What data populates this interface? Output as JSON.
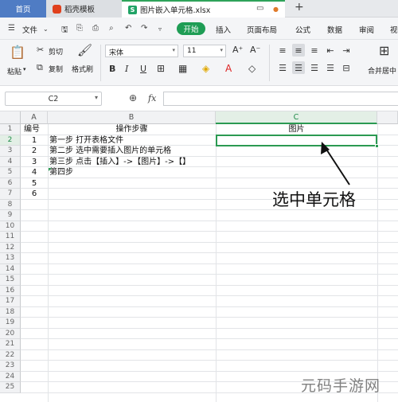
{
  "tabs": {
    "home": "首页",
    "daoke": "稻壳模板",
    "file": "图片嵌入单元格.xlsx",
    "s_icon": "S",
    "add": "+"
  },
  "menu": {
    "file": "文件",
    "start": "开始",
    "insert": "插入",
    "page_layout": "页面布局",
    "formula": "公式",
    "data": "数据",
    "review": "审阅",
    "view_partial": "视"
  },
  "ribbon": {
    "paste": "粘贴",
    "cut": "剪切",
    "copy": "复制",
    "format_painter": "格式刷",
    "font_name": "宋体",
    "font_size": "11",
    "bold": "B",
    "italic": "I",
    "underline": "U",
    "merge_center": "合并居中"
  },
  "formula_bar": {
    "name_box": "C2",
    "fx": "fx"
  },
  "sheet": {
    "columns": [
      "A",
      "B",
      "C"
    ],
    "rows": [
      "1",
      "2",
      "3",
      "4",
      "5",
      "6",
      "7",
      "8",
      "9",
      "10",
      "11",
      "12",
      "13",
      "14",
      "15",
      "16",
      "17",
      "18",
      "19",
      "20",
      "21",
      "22",
      "23",
      "24",
      "25"
    ],
    "header": {
      "A1": "编号",
      "B1": "操作步骤",
      "C1": "图片"
    },
    "data": [
      {
        "no": "1",
        "step": "第一步  打开表格文件"
      },
      {
        "no": "2",
        "step": "第二步  选中需要插入图片的单元格"
      },
      {
        "no": "3",
        "step": "第三步  点击【插入】->【图片】->【】"
      },
      {
        "no": "4",
        "step": "第四步"
      },
      {
        "no": "5",
        "step": ""
      },
      {
        "no": "6",
        "step": ""
      }
    ],
    "selected_cell": "C2"
  },
  "annotation": "选中单元格",
  "watermark": "元码手游网"
}
